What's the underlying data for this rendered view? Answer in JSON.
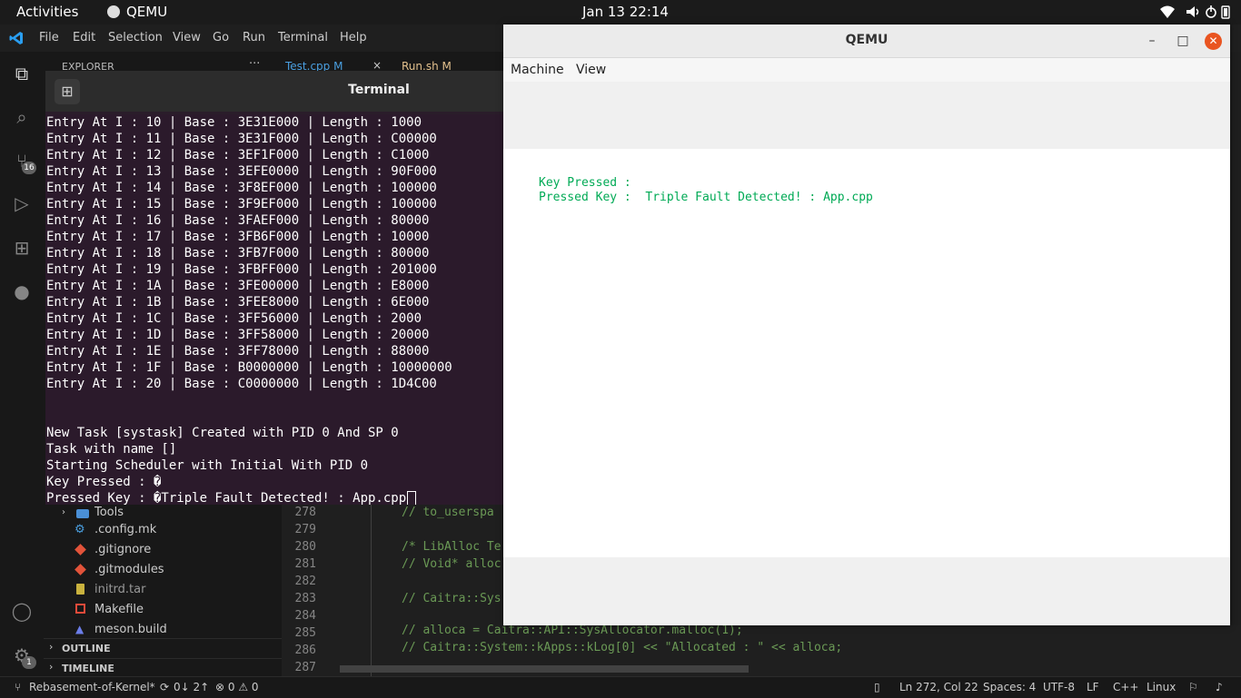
{
  "topbar": {
    "activities": "Activities",
    "app_name": "QEMU",
    "clock": "Jan 13  22:14",
    "indicators": [
      "wifi-icon",
      "speaker-icon",
      "power-icon",
      "battery-icon"
    ]
  },
  "vscode": {
    "menu": [
      "File",
      "Edit",
      "Selection",
      "View",
      "Go",
      "Run",
      "Terminal",
      "Help"
    ],
    "explorer_label": "EXPLORER",
    "tabs": [
      {
        "label": "Test.cpp M"
      },
      {
        "label": "Run.sh M"
      }
    ],
    "activity_badges": {
      "source_control": "16",
      "accounts": "1"
    },
    "files": [
      {
        "name": "Tools",
        "type": "folder"
      },
      {
        "name": ".config.mk",
        "type": "gear"
      },
      {
        "name": ".gitignore",
        "type": "git"
      },
      {
        "name": ".gitmodules",
        "type": "git"
      },
      {
        "name": "initrd.tar",
        "type": "archive"
      },
      {
        "name": "Makefile",
        "type": "make"
      },
      {
        "name": "meson.build",
        "type": "meson"
      }
    ],
    "sections": [
      "OUTLINE",
      "TIMELINE"
    ],
    "line_numbers": [
      "278",
      "279",
      "280",
      "281",
      "282",
      "283",
      "284",
      "285",
      "286",
      "287"
    ],
    "code_lines": [
      "// to_userspa",
      "",
      "/* LibAlloc Te",
      "// Void* alloc",
      "",
      "// Caitra::Sys",
      "",
      "// alloca = Caitra::API::SysAllocator.malloc(1);",
      "// Caitra::System::kApps::kLog[0] << \"Allocated : \" << alloca;",
      ""
    ],
    "status": {
      "branch": "Rebasement-of-Kernel*",
      "sync": "0↓ 2↑",
      "problems": "⊗ 0 ⚠ 0",
      "position": "Ln 272, Col 22",
      "spaces": "Spaces: 4",
      "encoding": "UTF-8",
      "eol": "LF",
      "language": "C++",
      "platform": "Linux"
    }
  },
  "terminal": {
    "title": "Terminal",
    "lines": [
      "Entry At I : 10 | Base : 3E31E000 | Length : 1000",
      "Entry At I : 11 | Base : 3E31F000 | Length : C00000",
      "Entry At I : 12 | Base : 3EF1F000 | Length : C1000",
      "Entry At I : 13 | Base : 3EFE0000 | Length : 90F000",
      "Entry At I : 14 | Base : 3F8EF000 | Length : 100000",
      "Entry At I : 15 | Base : 3F9EF000 | Length : 100000",
      "Entry At I : 16 | Base : 3FAEF000 | Length : 80000",
      "Entry At I : 17 | Base : 3FB6F000 | Length : 10000",
      "Entry At I : 18 | Base : 3FB7F000 | Length : 80000",
      "Entry At I : 19 | Base : 3FBFF000 | Length : 201000",
      "Entry At I : 1A | Base : 3FE00000 | Length : E8000",
      "Entry At I : 1B | Base : 3FEE8000 | Length : 6E000",
      "Entry At I : 1C | Base : 3FF56000 | Length : 2000",
      "Entry At I : 1D | Base : 3FF58000 | Length : 20000",
      "Entry At I : 1E | Base : 3FF78000 | Length : 88000",
      "Entry At I : 1F | Base : B0000000 | Length : 10000000",
      "Entry At I : 20 | Base : C0000000 | Length : 1D4C00",
      "",
      "",
      "New Task [systask] Created with PID 0 And SP 0",
      "Task with name []",
      "Starting Scheduler with Initial With PID 0",
      "Key Pressed : �",
      "Pressed Key : �Triple Fault Detected! : App.cpp"
    ]
  },
  "qemu": {
    "title": "QEMU",
    "menu": [
      "Machine",
      "View"
    ],
    "screen_lines": [
      "Key Pressed :",
      "Pressed Key :  Triple Fault Detected! : App.cpp"
    ]
  }
}
